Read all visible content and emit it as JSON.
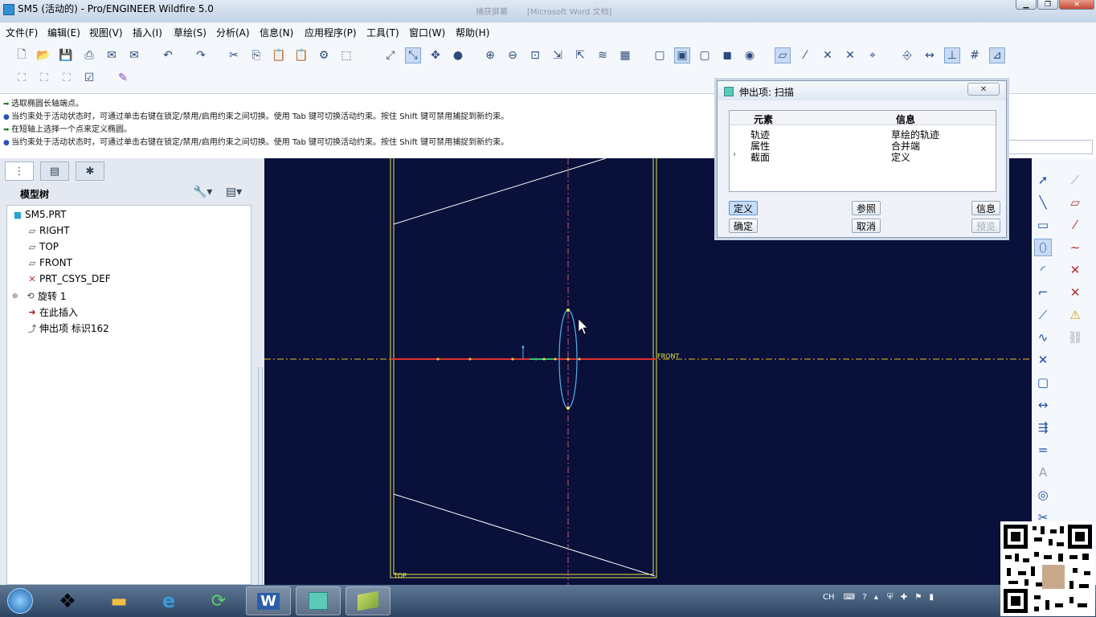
{
  "window": {
    "title": "SM5 (活动的) - Pro/ENGINEER Wildfire 5.0",
    "faint_title_1": "捕获屏幕",
    "faint_title_2": "[Microsoft Word 文档]"
  },
  "menu": [
    "文件(F)",
    "编辑(E)",
    "视图(V)",
    "插入(I)",
    "草绘(S)",
    "分析(A)",
    "信息(N)",
    "应用程序(P)",
    "工具(T)",
    "窗口(W)",
    "帮助(H)"
  ],
  "messages": [
    {
      "kind": "prompt",
      "text": "选取椭圆长轴端点。"
    },
    {
      "kind": "info",
      "text": "当约束处于活动状态时，可通过单击右键在锁定/禁用/启用约束之间切换。使用 Tab 键可切换活动约束。按住 Shift 键可禁用捕捉到新约束。"
    },
    {
      "kind": "prompt",
      "text": "在短轴上选择一个点来定义椭圆。"
    },
    {
      "kind": "info",
      "text": "当约束处于活动状态时，可通过单击右键在锁定/禁用/启用约束之间切换。使用 Tab 键可切换活动约束。按住 Shift 键可禁用捕捉到新约束。"
    }
  ],
  "model_tree": {
    "title": "模型树",
    "items": [
      {
        "label": "SM5.PRT",
        "icon": "part-icon"
      },
      {
        "label": "RIGHT",
        "icon": "datum-plane-icon"
      },
      {
        "label": "TOP",
        "icon": "datum-plane-icon"
      },
      {
        "label": "FRONT",
        "icon": "datum-plane-icon"
      },
      {
        "label": "PRT_CSYS_DEF",
        "icon": "csys-icon"
      },
      {
        "label": "旋转 1",
        "icon": "revolve-icon"
      },
      {
        "label": "在此插入",
        "icon": "insert-arrow-icon"
      },
      {
        "label": "伸出项 标识162",
        "icon": "sweep-icon"
      }
    ]
  },
  "canvas": {
    "front_label": "FRONT",
    "top_label": "TOP"
  },
  "dialog": {
    "title": "伸出项: 扫描",
    "col_element": "元素",
    "col_info": "信息",
    "rows": [
      {
        "el": "轨迹",
        "info": "草绘的轨迹"
      },
      {
        "el": "属性",
        "info": "合并端"
      },
      {
        "el": "截面",
        "info": "定义"
      }
    ],
    "btn_define": "定义",
    "btn_ref": "参照",
    "btn_info": "信息",
    "btn_ok": "确定",
    "btn_cancel": "取消",
    "btn_preview": "预览"
  },
  "taskbar": {
    "lang": "CH"
  }
}
